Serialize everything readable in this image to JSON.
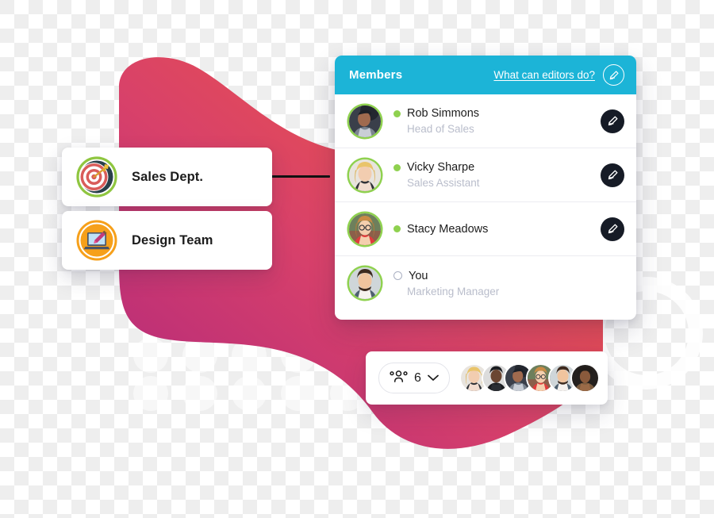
{
  "teams": [
    {
      "label": "Sales Dept.",
      "icon": "target-dartboard-icon"
    },
    {
      "label": "Design Team",
      "icon": "laptop-paintbrush-icon"
    }
  ],
  "members_panel": {
    "header": {
      "title": "Members",
      "editors_link": "What can editors do?",
      "edit_icon": "pencil-circle-icon",
      "background_color": "#1cb4d7"
    },
    "rows": [
      {
        "name": "Rob Simmons",
        "role": "Head of Sales",
        "status": "online",
        "edit_icon": "pencil-icon"
      },
      {
        "name": "Vicky Sharpe",
        "role": "Sales Assistant",
        "status": "online",
        "edit_icon": "pencil-icon"
      },
      {
        "name": "Stacy Meadows",
        "role": "",
        "status": "online",
        "edit_icon": "pencil-icon"
      },
      {
        "name": "You",
        "role": "Marketing Manager",
        "status": "offline",
        "edit_icon": ""
      }
    ],
    "status_colors": {
      "online": "#8fd14f",
      "offline": "#aab0c2"
    }
  },
  "members_bar": {
    "group_icon": "people-group-icon",
    "count": "6",
    "chevron_icon": "chevron-down-icon",
    "avatar_count": 6
  },
  "decor": {
    "blob_gradient": [
      "#e8504f",
      "#b92a7e"
    ],
    "accent_blue": "#1cb4d7",
    "accent_green": "#8fd14f",
    "accent_orange": "#f6a01b"
  }
}
